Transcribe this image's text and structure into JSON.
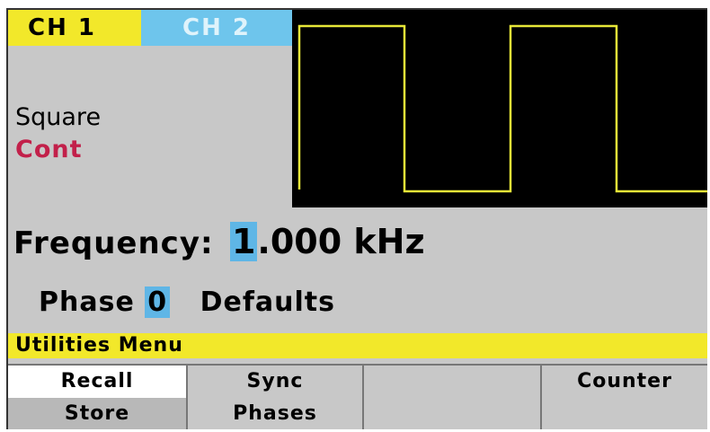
{
  "channels": {
    "ch1": "CH 1",
    "ch2": "CH 2"
  },
  "waveform": {
    "type": "Square",
    "mode": "Cont"
  },
  "frequency": {
    "label": "Frequency:",
    "cursor_digit": "1",
    "value_rest": ".000 kHz"
  },
  "phase": {
    "label": "Phase",
    "value": "0",
    "defaults": "Defaults"
  },
  "menu": {
    "title": "Utilities Menu"
  },
  "softkeys": [
    {
      "line1": "Recall",
      "line2": "Store"
    },
    {
      "line1": "Sync",
      "line2": "Phases"
    },
    {
      "line1": "",
      "line2": ""
    },
    {
      "line1": "Counter",
      "line2": ""
    }
  ],
  "colors": {
    "ch1": "#f2e82a",
    "ch2": "#6ec5ec",
    "trace": "#e8e838",
    "mode": "#c2204a",
    "cursor": "#5fb6e6"
  }
}
